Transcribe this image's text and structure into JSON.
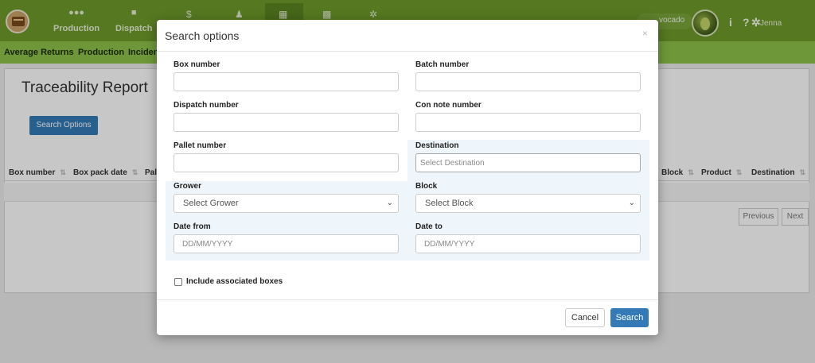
{
  "nav": {
    "items": [
      {
        "label": "Production",
        "icon": "users-icon"
      },
      {
        "label": "Dispatch",
        "icon": "truck-icon"
      }
    ],
    "icon_items": [
      {
        "icon": "dollar-icon",
        "glyph": "$"
      },
      {
        "icon": "person-icon",
        "glyph": "♟"
      },
      {
        "icon": "table-icon",
        "glyph": "▦"
      },
      {
        "icon": "grid-icon",
        "glyph": "▩"
      },
      {
        "icon": "cog-icon",
        "glyph": "✲"
      }
    ],
    "crop": "vocado",
    "user": "Jenna",
    "colors": {
      "bar": "#6d9a2a",
      "subbar": "#8cc24a",
      "primary": "#337ab7"
    }
  },
  "subnav": [
    "Average Returns",
    "Production",
    "Inciden"
  ],
  "page": {
    "title": "Traceability Report",
    "search_options_button": "Search Options",
    "columns_left": [
      "Box number",
      "Box pack date",
      "Pal"
    ],
    "columns_right": [
      "Block",
      "Product",
      "Destination"
    ],
    "pager": {
      "previous": "Previous",
      "next": "Next"
    }
  },
  "modal": {
    "title": "Search options",
    "close": "×",
    "fields": {
      "box_number": {
        "label": "Box number",
        "value": ""
      },
      "batch_number": {
        "label": "Batch number",
        "value": ""
      },
      "dispatch_number": {
        "label": "Dispatch number",
        "value": ""
      },
      "con_note_number": {
        "label": "Con note number",
        "value": ""
      },
      "pallet_number": {
        "label": "Pallet number",
        "value": ""
      },
      "destination": {
        "label": "Destination",
        "placeholder": "Select Destination"
      },
      "grower": {
        "label": "Grower",
        "selected": "Select Grower"
      },
      "block": {
        "label": "Block",
        "selected": "Select Block"
      },
      "date_from": {
        "label": "Date from",
        "placeholder": "DD/MM/YYYY"
      },
      "date_to": {
        "label": "Date to",
        "placeholder": "DD/MM/YYYY"
      }
    },
    "include_associated": {
      "label": "Include associated boxes",
      "checked": false
    },
    "cancel": "Cancel",
    "search": "Search"
  }
}
